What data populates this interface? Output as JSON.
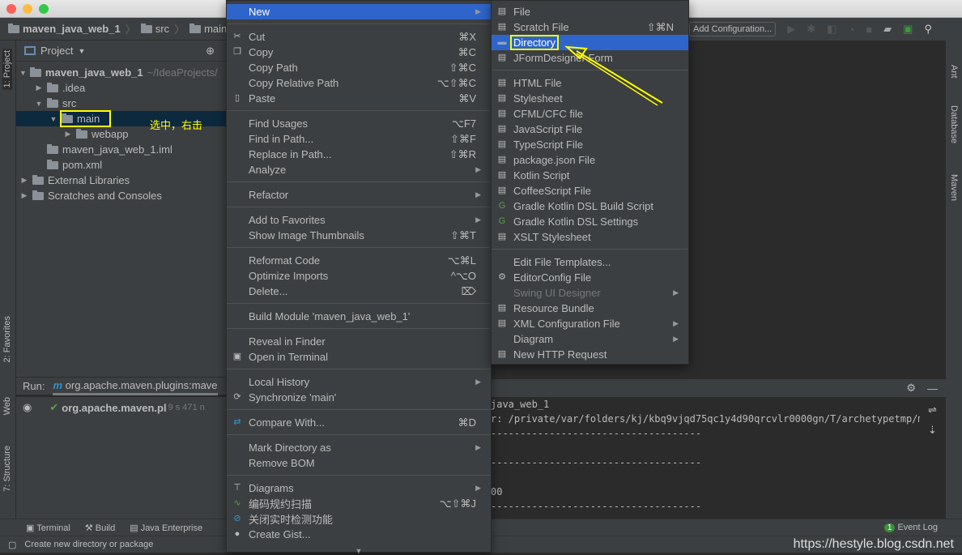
{
  "window": {
    "traffic_lights": [
      "#fc605c",
      "#fdbc40",
      "#34c84a"
    ]
  },
  "breadcrumb": [
    "maven_java_web_1",
    "src",
    "main"
  ],
  "toolbar": {
    "add_configuration": "Add Configuration..."
  },
  "left_stripe": {
    "project": "1: Project",
    "favorites": "2: Favorites",
    "web": "Web",
    "structure": "7: Structure"
  },
  "right_stripe": {
    "ant": "Ant",
    "database": "Database",
    "maven": "Maven"
  },
  "project_panel": {
    "title": "Project",
    "tree": [
      {
        "label": "maven_java_web_1",
        "hint": "~/IdeaProjects/",
        "level": 0,
        "expanded": true,
        "bold": true
      },
      {
        "label": ".idea",
        "level": 1,
        "expanded": false
      },
      {
        "label": "src",
        "level": 1,
        "expanded": true
      },
      {
        "label": "main",
        "level": 2,
        "expanded": true,
        "selected": true
      },
      {
        "label": "webapp",
        "level": 3,
        "expanded": false
      },
      {
        "label": "maven_java_web_1.iml",
        "level": 1
      },
      {
        "label": "pom.xml",
        "level": 1
      },
      {
        "label": "External Libraries",
        "level": 0,
        "expanded": false
      },
      {
        "label": "Scratches and Consoles",
        "level": 0,
        "expanded": false
      }
    ],
    "annotation": "选中，右击"
  },
  "run_panel": {
    "label": "Run:",
    "tab": "org.apache.maven.plugins:mave",
    "item": "org.apache.maven.pl",
    "time": "9 s 471 n"
  },
  "bottom_bar": {
    "terminal": "Terminal",
    "build": "Build",
    "java_enterprise": "Java Enterprise",
    "event_log": "Event Log",
    "event_count": "1"
  },
  "status_bar": {
    "message": "Create new directory or package",
    "watermark": "https://hestyle.blog.csdn.net"
  },
  "console": {
    "lines": [
      "java_web_1",
      "r: /private/var/folders/kj/kbq9vjqd75qc1y4d90qrcvlr0000gn/T/archetypetmp/mav",
      "------------------------------------",
      "",
      "------------------------------------",
      "",
      "00",
      "------------------------------------"
    ]
  },
  "context_menu": {
    "groups": [
      [
        {
          "label": "New",
          "submenu": true,
          "active": true
        }
      ],
      [
        {
          "label": "Cut",
          "shortcut": "⌘X",
          "icon": "scissors-icon"
        },
        {
          "label": "Copy",
          "shortcut": "⌘C",
          "icon": "copy-icon"
        },
        {
          "label": "Copy Path",
          "shortcut": "⇧⌘C"
        },
        {
          "label": "Copy Relative Path",
          "shortcut": "⌥⇧⌘C"
        },
        {
          "label": "Paste",
          "shortcut": "⌘V",
          "icon": "paste-icon"
        }
      ],
      [
        {
          "label": "Find Usages",
          "shortcut": "⌥F7"
        },
        {
          "label": "Find in Path...",
          "shortcut": "⇧⌘F"
        },
        {
          "label": "Replace in Path...",
          "shortcut": "⇧⌘R"
        },
        {
          "label": "Analyze",
          "submenu": true
        }
      ],
      [
        {
          "label": "Refactor",
          "submenu": true
        }
      ],
      [
        {
          "label": "Add to Favorites",
          "submenu": true
        },
        {
          "label": "Show Image Thumbnails",
          "shortcut": "⇧⌘T"
        }
      ],
      [
        {
          "label": "Reformat Code",
          "shortcut": "⌥⌘L"
        },
        {
          "label": "Optimize Imports",
          "shortcut": "^⌥O"
        },
        {
          "label": "Delete...",
          "shortcut": "⌦"
        }
      ],
      [
        {
          "label": "Build Module 'maven_java_web_1'"
        }
      ],
      [
        {
          "label": "Reveal in Finder"
        },
        {
          "label": "Open in Terminal",
          "icon": "terminal-icon"
        }
      ],
      [
        {
          "label": "Local History",
          "submenu": true
        },
        {
          "label": "Synchronize 'main'",
          "icon": "sync-icon"
        }
      ],
      [
        {
          "label": "Compare With...",
          "shortcut": "⌘D",
          "icon": "compare-icon"
        }
      ],
      [
        {
          "label": "Mark Directory as",
          "submenu": true
        },
        {
          "label": "Remove BOM"
        }
      ],
      [
        {
          "label": "Diagrams",
          "submenu": true,
          "icon": "diagram-icon"
        },
        {
          "label": "编码规约扫描",
          "shortcut": "⌥⇧⌘J",
          "icon": "scan-icon"
        },
        {
          "label": "关闭实时检测功能",
          "icon": "disable-icon"
        },
        {
          "label": "Create Gist...",
          "icon": "github-icon"
        }
      ]
    ]
  },
  "new_submenu": {
    "groups": [
      [
        {
          "label": "File",
          "icon": "file-icon"
        },
        {
          "label": "Scratch File",
          "shortcut": "⇧⌘N",
          "icon": "scratch-icon"
        },
        {
          "label": "Directory",
          "icon": "folder-icon",
          "active": true
        },
        {
          "label": "JFormDesigner Form",
          "icon": "form-icon"
        }
      ],
      [
        {
          "label": "HTML File",
          "icon": "html-icon"
        },
        {
          "label": "Stylesheet",
          "icon": "css-icon"
        },
        {
          "label": "CFML/CFC file",
          "icon": "cf-icon"
        },
        {
          "label": "JavaScript File",
          "icon": "js-icon"
        },
        {
          "label": "TypeScript File",
          "icon": "ts-icon"
        },
        {
          "label": "package.json File",
          "icon": "nodejs-icon"
        },
        {
          "label": "Kotlin Script",
          "icon": "kotlin-icon"
        },
        {
          "label": "CoffeeScript File",
          "icon": "coffee-icon"
        },
        {
          "label": "Gradle Kotlin DSL Build Script",
          "icon": "gradle-icon"
        },
        {
          "label": "Gradle Kotlin DSL Settings",
          "icon": "gradle-icon"
        },
        {
          "label": "XSLT Stylesheet",
          "icon": "xslt-icon"
        }
      ],
      [
        {
          "label": "Edit File Templates..."
        },
        {
          "label": "EditorConfig File",
          "icon": "gear-icon"
        },
        {
          "label": "Swing UI Designer",
          "submenu": true,
          "disabled": true
        },
        {
          "label": "Resource Bundle",
          "icon": "bundle-icon"
        },
        {
          "label": "XML Configuration File",
          "submenu": true,
          "icon": "xml-icon"
        },
        {
          "label": "Diagram",
          "submenu": true
        },
        {
          "label": "New HTTP Request",
          "icon": "api-icon"
        }
      ]
    ]
  },
  "annotation_color": "#ffff00"
}
